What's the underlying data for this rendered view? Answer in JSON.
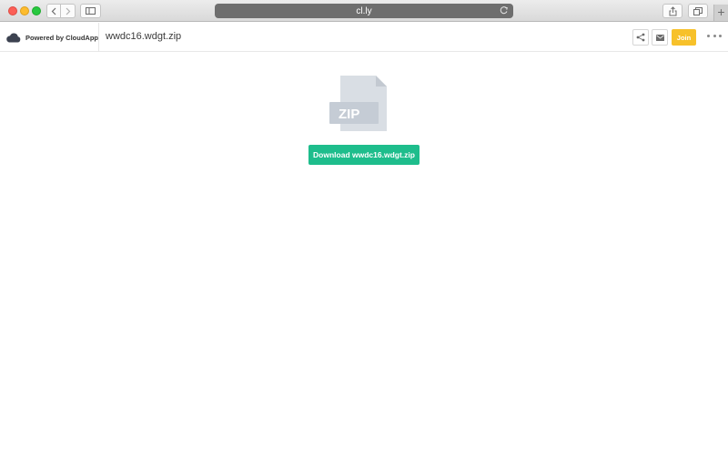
{
  "browser": {
    "address": "cl.ly"
  },
  "header": {
    "brand_label": "Powered by CloudApp",
    "file_name": "wwdc16.wdgt.zip",
    "join_label": "Join"
  },
  "main": {
    "file_type_label": "ZIP",
    "download_label": "Download wwdc16.wdgt.zip"
  },
  "colors": {
    "download": "#1ebd8c",
    "join": "#f7c12a",
    "file_icon": "#d9dee4"
  }
}
